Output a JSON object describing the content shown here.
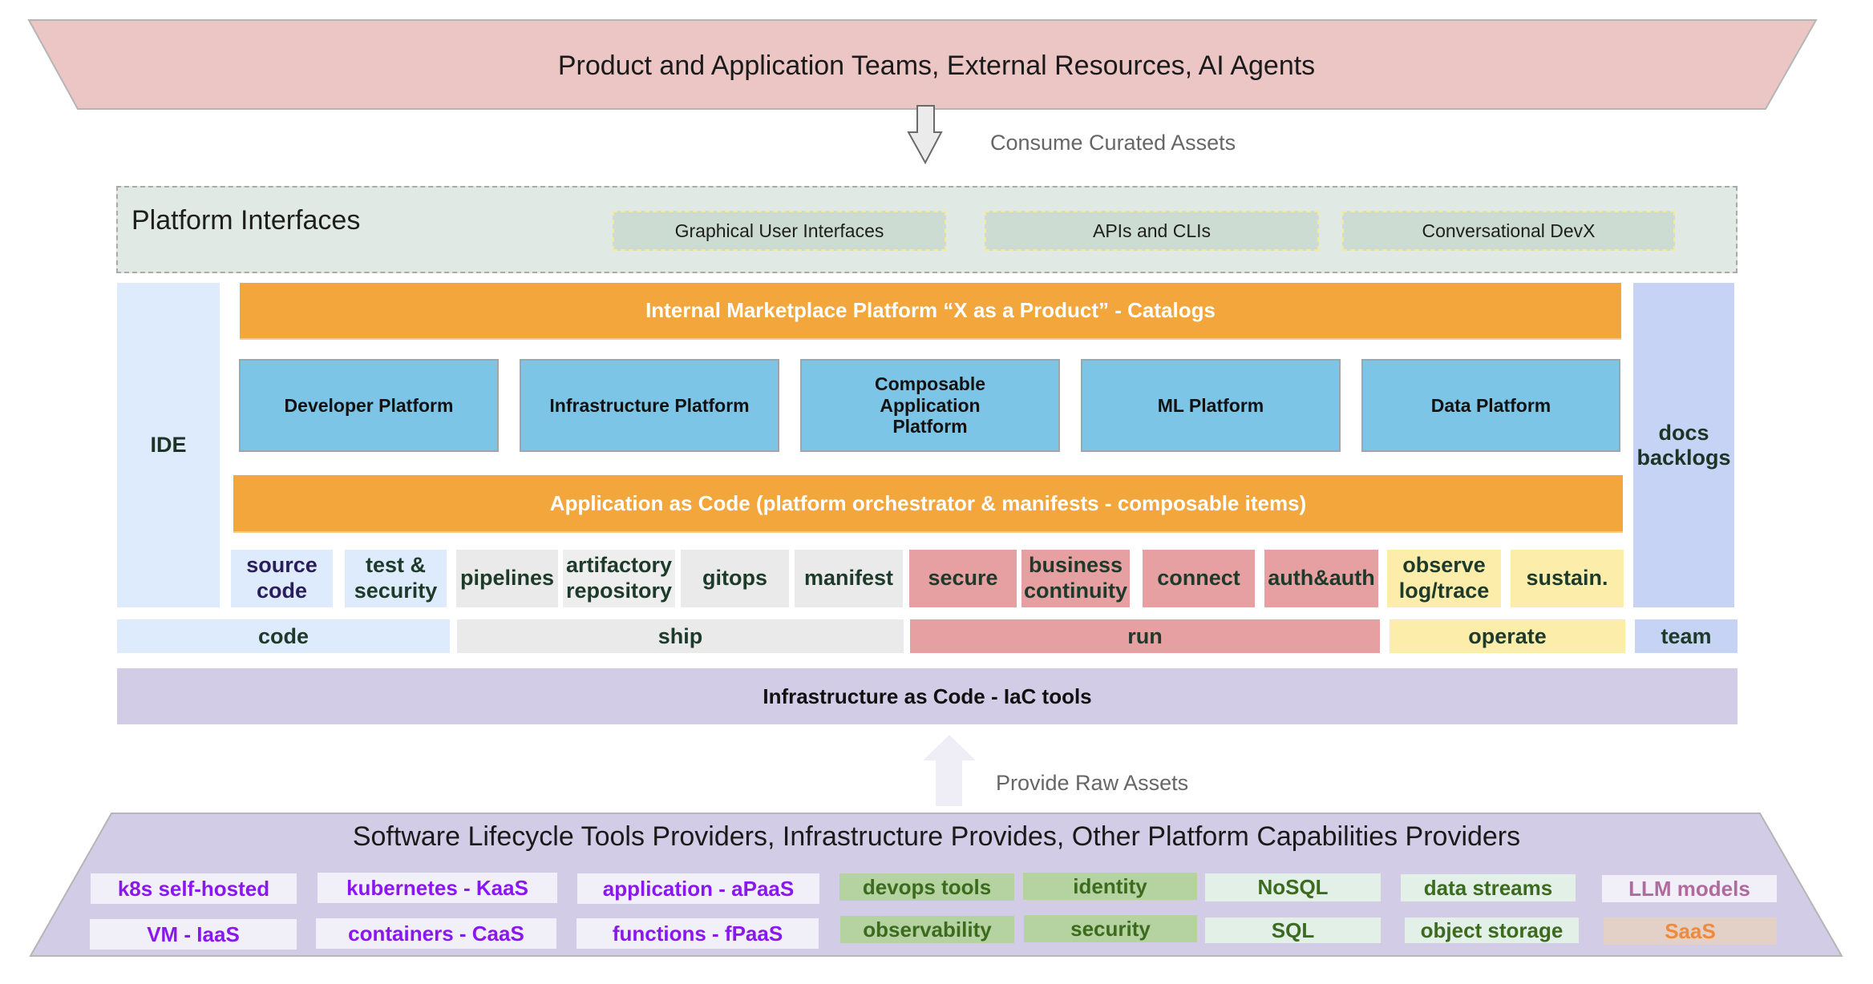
{
  "consumers": {
    "title": "Product and Application Teams, External Resources, AI Agents",
    "color": "#ecc5c5"
  },
  "flow_down": {
    "label": "Consume Curated Assets",
    "icon": "arrow-down-icon"
  },
  "platform_interfaces": {
    "title": "Platform Interfaces",
    "items": [
      "Graphical User Interfaces",
      "APIs and CLIs",
      "Conversational DevX"
    ]
  },
  "ide": {
    "label": "IDE",
    "color": "#deebfc"
  },
  "docs": {
    "label": "docs backlogs",
    "color": "#c6d3f5"
  },
  "marketplace": {
    "label": "Internal Marketplace Platform “X as a Product” - Catalogs",
    "color": "#f2a63c"
  },
  "platforms": [
    "Developer Platform",
    "Infrastructure Platform",
    "Composable Application Platform",
    "ML Platform",
    "Data Platform"
  ],
  "app_as_code": {
    "label": "Application as Code (platform orchestrator & manifests - composable items)"
  },
  "capabilities": [
    {
      "label": "source code",
      "group": "code"
    },
    {
      "label": "test & security",
      "group": "code"
    },
    {
      "label": "pipelines",
      "group": "ship"
    },
    {
      "label": "artifactory repository",
      "group": "ship"
    },
    {
      "label": "gitops",
      "group": "ship"
    },
    {
      "label": "manifest",
      "group": "ship"
    },
    {
      "label": "secure",
      "group": "run"
    },
    {
      "label": "business continuity",
      "group": "run"
    },
    {
      "label": "connect",
      "group": "run"
    },
    {
      "label": "auth&auth",
      "group": "run"
    },
    {
      "label": "observe log/trace",
      "group": "operate"
    },
    {
      "label": "sustain.",
      "group": "operate"
    }
  ],
  "stages": [
    {
      "label": "code",
      "color": "#deebfc"
    },
    {
      "label": "ship",
      "color": "#eaeaea"
    },
    {
      "label": "run",
      "color": "#e6a0a2"
    },
    {
      "label": "operate",
      "color": "#fcedab"
    },
    {
      "label": "team",
      "color": "#c6d3f5"
    }
  ],
  "iac": {
    "label": "Infrastructure as Code - IaC tools"
  },
  "flow_up": {
    "label": "Provide Raw Assets",
    "icon": "arrow-up-icon"
  },
  "providers": {
    "title": "Software Lifecycle Tools Providers, Infrastructure Provides, Other Platform Capabilities Providers",
    "color": "#d2cce6",
    "row1": [
      "k8s self-hosted",
      "kubernetes - KaaS",
      "application - aPaaS",
      "devops tools",
      "identity",
      "NoSQL",
      "data streams",
      "LLM models"
    ],
    "row2": [
      "VM - IaaS",
      "containers - CaaS",
      "functions - fPaaS",
      "observability",
      "security",
      "SQL",
      "object storage",
      "SaaS"
    ]
  }
}
